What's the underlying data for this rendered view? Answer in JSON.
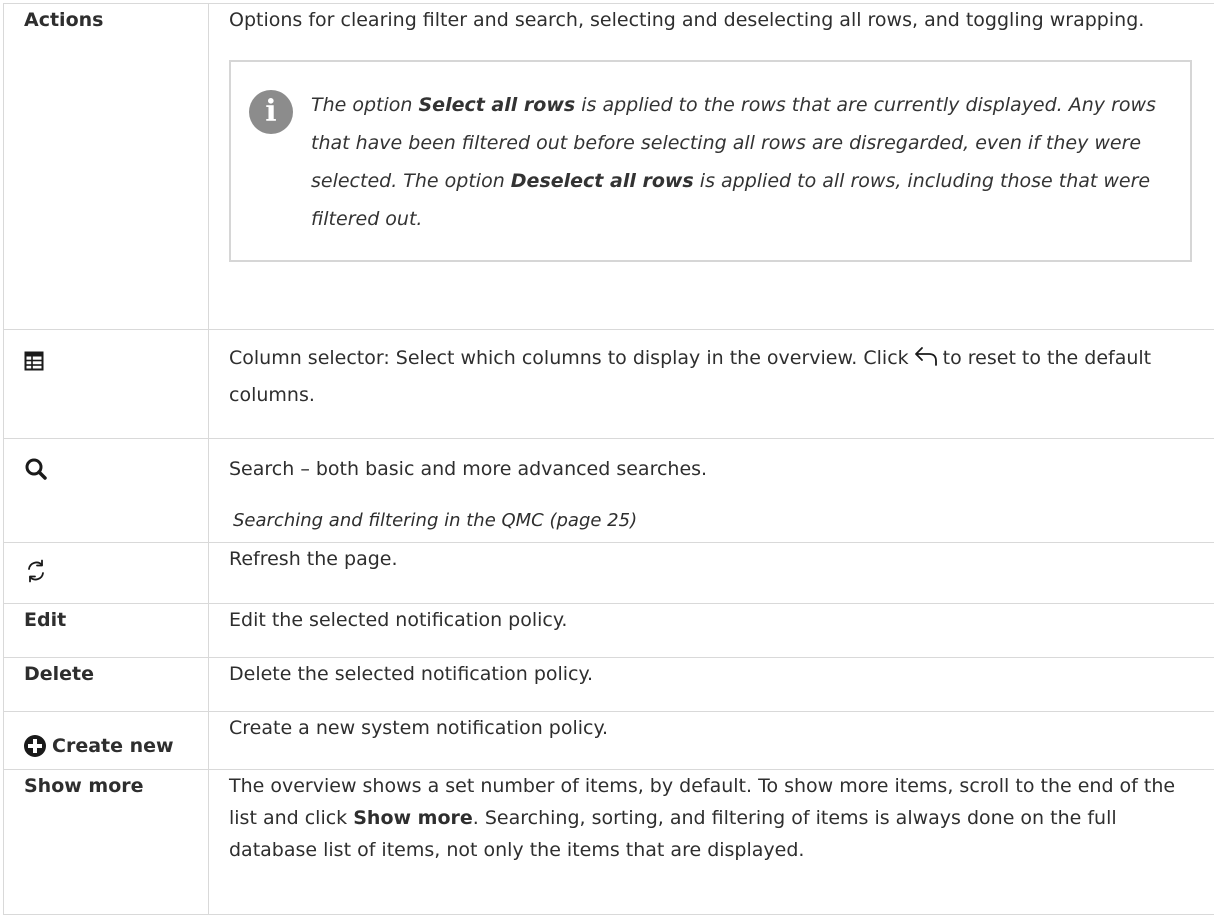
{
  "rows": [
    {
      "term": "Actions",
      "description": "Options for clearing filter and search, selecting and deselecting all rows, and toggling wrapping.",
      "note": {
        "icon": "info-icon",
        "part1": "The option ",
        "bold1": "Select all rows",
        "part2": " is applied to the rows that are currently displayed. Any rows that have been filtered out before selecting all rows are disregarded, even if they were selected. The option ",
        "bold2": "Deselect all rows",
        "part3": " is applied to all rows, including those that were filtered out."
      }
    },
    {
      "icon": "column-selector-icon",
      "description_before": "Column selector: Select which columns to display in the overview. Click",
      "inline_icon": "undo-arrow-icon",
      "description_after": "to reset to the default columns."
    },
    {
      "icon": "search-icon",
      "description": "Search – both basic and more advanced searches.",
      "xref": "Searching and filtering in the QMC (page 25)"
    },
    {
      "icon": "refresh-icon",
      "description": "Refresh the page."
    },
    {
      "term": "Edit",
      "description": "Edit the selected notification policy."
    },
    {
      "term": "Delete",
      "description": "Delete the selected notification policy."
    },
    {
      "icon": "plus-circle-icon",
      "term": "Create new",
      "description": "Create a new system notification policy."
    },
    {
      "term": "Show more",
      "description_before": "The overview shows a set number of items, by default. To show more items, scroll to the end of the list and click ",
      "bold": "Show more",
      "description_after": ". Searching, sorting, and filtering of items is always done on the full database list of items, not only the items that are displayed."
    }
  ]
}
